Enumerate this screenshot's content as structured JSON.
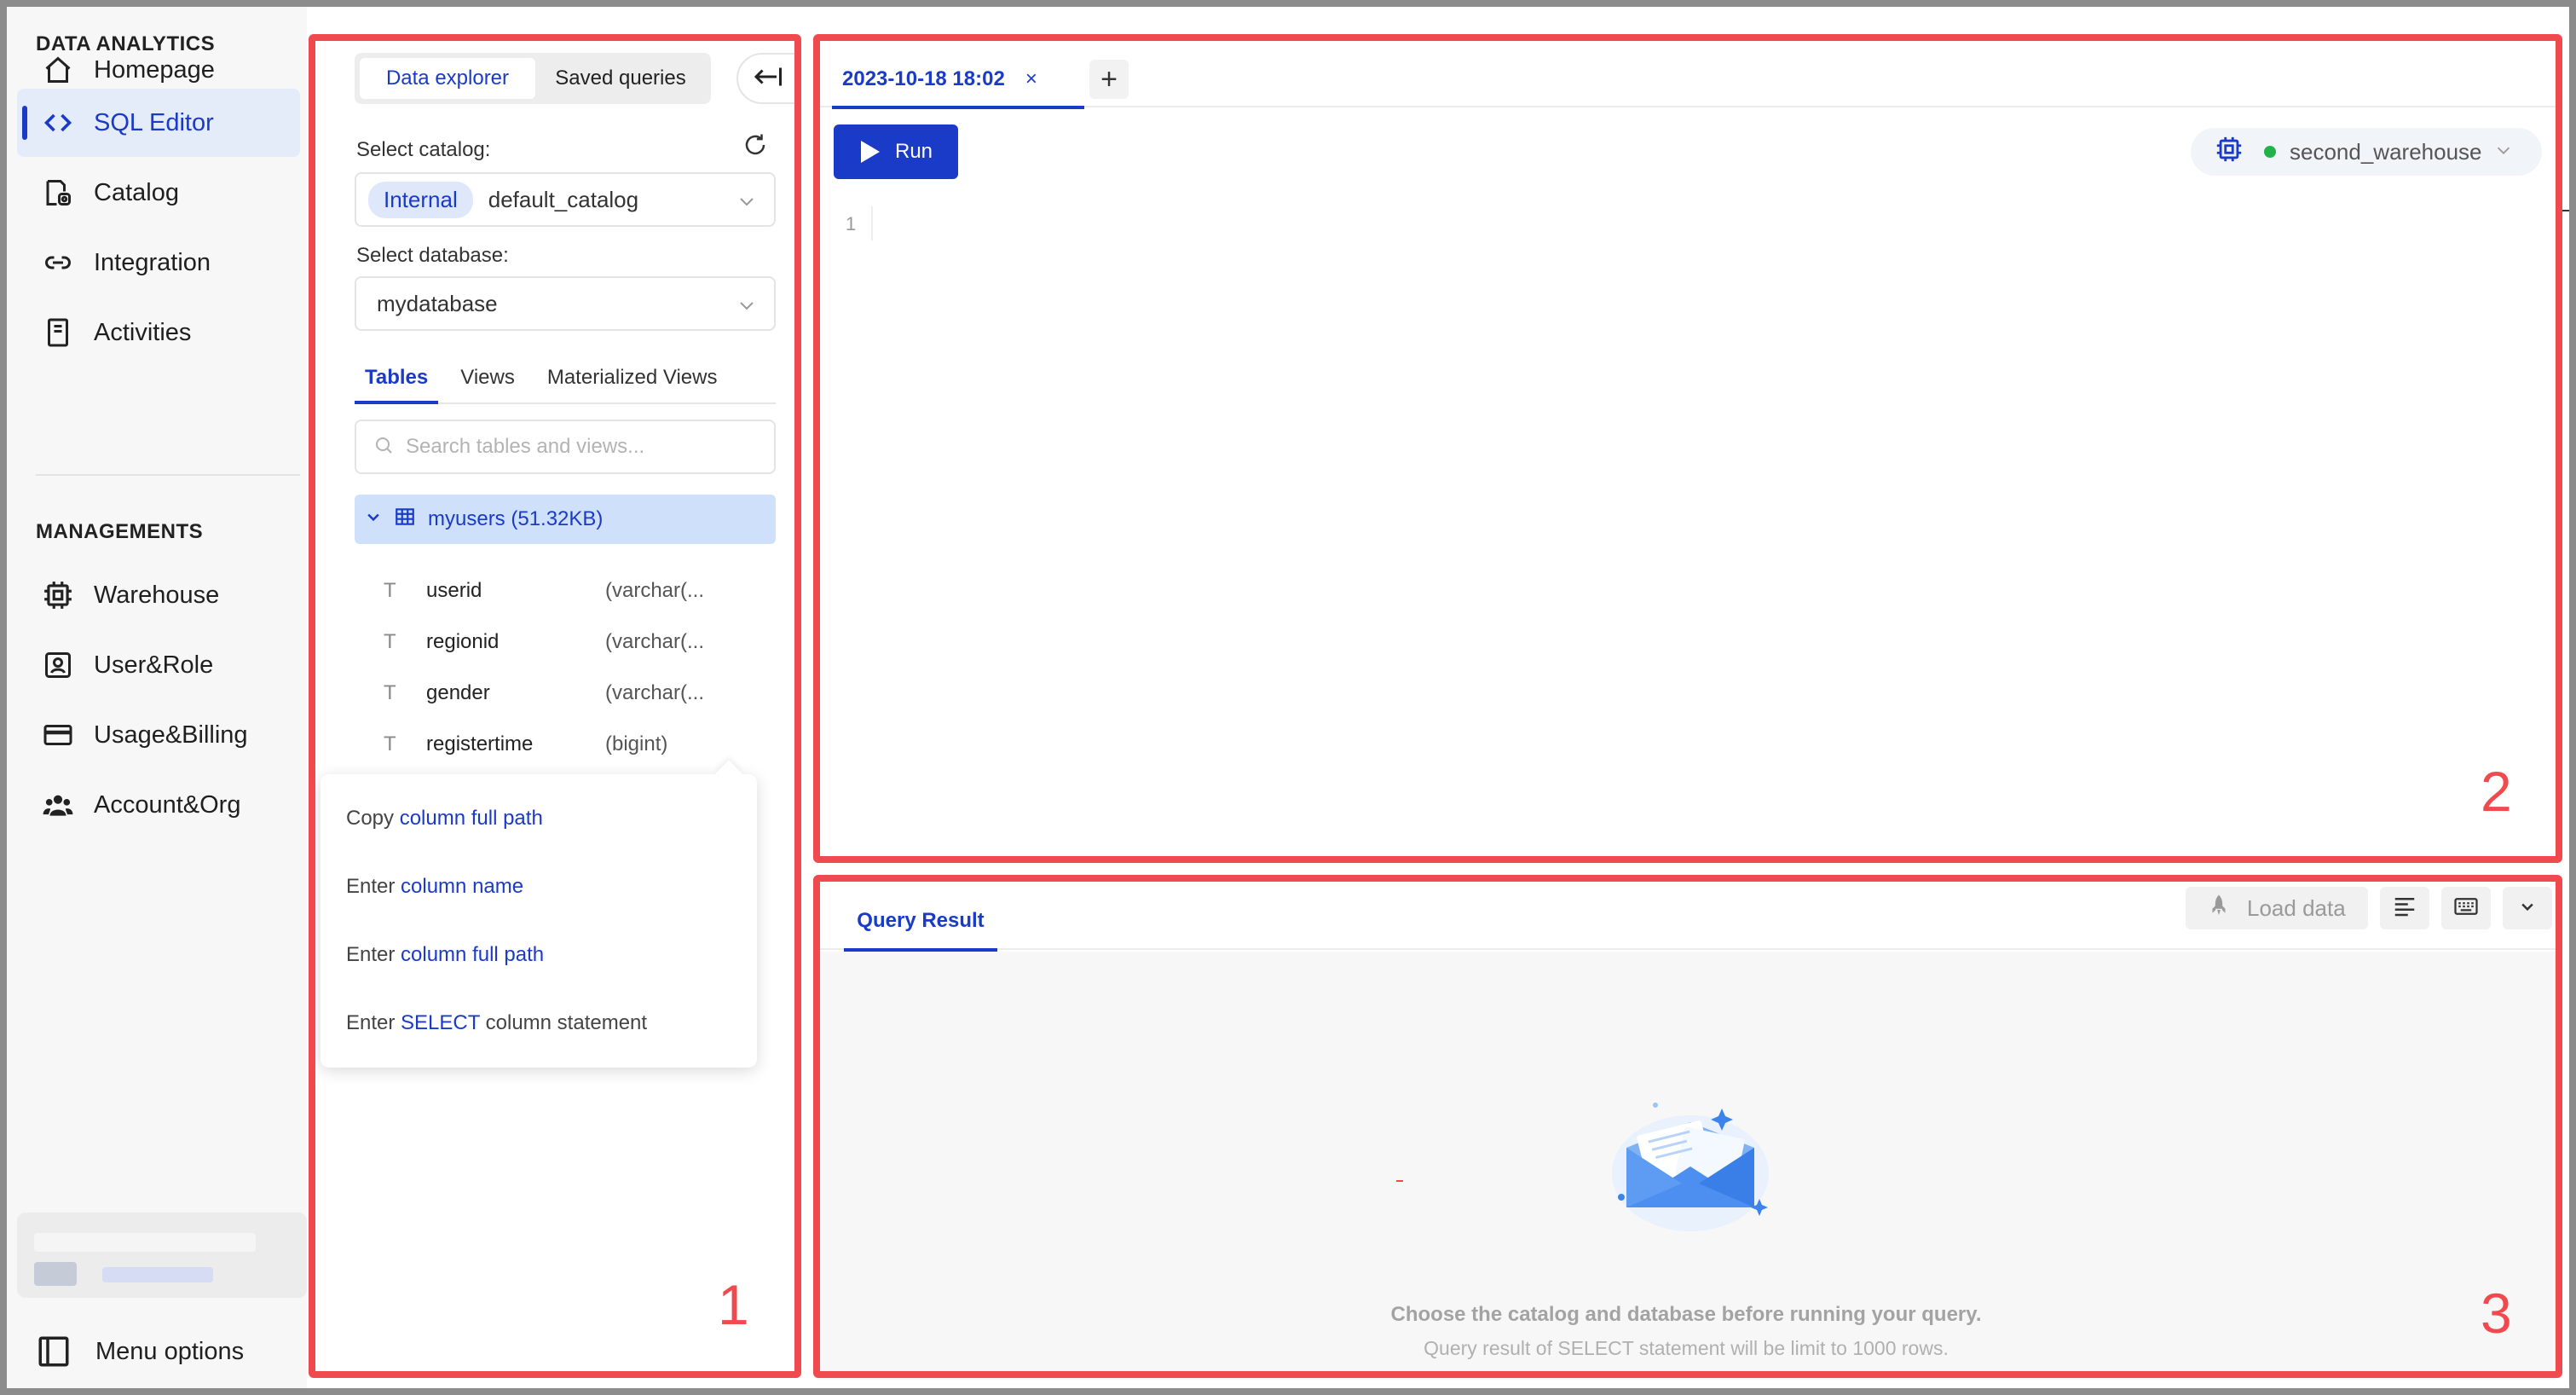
{
  "nav": {
    "section_analytics": "DATA ANALYTICS",
    "items_analytics": [
      {
        "label": "Homepage",
        "icon": "home-icon"
      },
      {
        "label": "SQL Editor",
        "icon": "code-icon"
      },
      {
        "label": "Catalog",
        "icon": "catalog-icon"
      },
      {
        "label": "Integration",
        "icon": "link-icon"
      },
      {
        "label": "Activities",
        "icon": "document-icon"
      }
    ],
    "section_managements": "MANAGEMENTS",
    "items_managements": [
      {
        "label": "Warehouse",
        "icon": "chip-icon"
      },
      {
        "label": "User&Role",
        "icon": "user-icon"
      },
      {
        "label": "Usage&Billing",
        "icon": "card-icon"
      },
      {
        "label": "Account&Org",
        "icon": "team-icon"
      }
    ],
    "active_item": "SQL Editor",
    "menu_options": "Menu options"
  },
  "explorer": {
    "tab_data_explorer": "Data explorer",
    "tab_saved_queries": "Saved queries",
    "catalog_label": "Select catalog:",
    "catalog_tag": "Internal",
    "catalog_value": "default_catalog",
    "database_label": "Select database:",
    "database_value": "mydatabase",
    "object_tabs": [
      "Tables",
      "Views",
      "Materialized Views"
    ],
    "active_object_tab": "Tables",
    "search_placeholder": "Search tables and views...",
    "table": {
      "name": "myusers (51.32KB)",
      "columns": [
        {
          "type_icon": "T",
          "name": "userid",
          "type": "(varchar(..."
        },
        {
          "type_icon": "T",
          "name": "regionid",
          "type": "(varchar(..."
        },
        {
          "type_icon": "T",
          "name": "gender",
          "type": "(varchar(..."
        },
        {
          "type_icon": "T",
          "name": "registertime",
          "type": "(bigint)"
        }
      ]
    },
    "context_menu": [
      {
        "prefix": "Copy ",
        "highlight": "column full path",
        "suffix": ""
      },
      {
        "prefix": "Enter ",
        "highlight": "column name",
        "suffix": ""
      },
      {
        "prefix": "Enter ",
        "highlight": "column full path",
        "suffix": ""
      },
      {
        "prefix": "Enter ",
        "highlight": "SELECT",
        "suffix": " column statement"
      }
    ]
  },
  "editor": {
    "tab_title": "2023-10-18 18:02",
    "tab_close": "×",
    "add_tab": "+",
    "run_label": "Run",
    "warehouse": "second_warehouse",
    "warehouse_status_color": "#22b24c",
    "line_number": "1"
  },
  "result": {
    "tab_label": "Query Result",
    "load_data_label": "Load data",
    "empty_title": "Choose the catalog and database before running your query.",
    "empty_subtitle": "Query result of SELECT statement will be limit to 1000 rows."
  },
  "annotations": {
    "box1": "1",
    "box2": "2",
    "box3": "3",
    "color": "#f04a4e"
  },
  "theme": {
    "accent": "#1a3ac8"
  }
}
